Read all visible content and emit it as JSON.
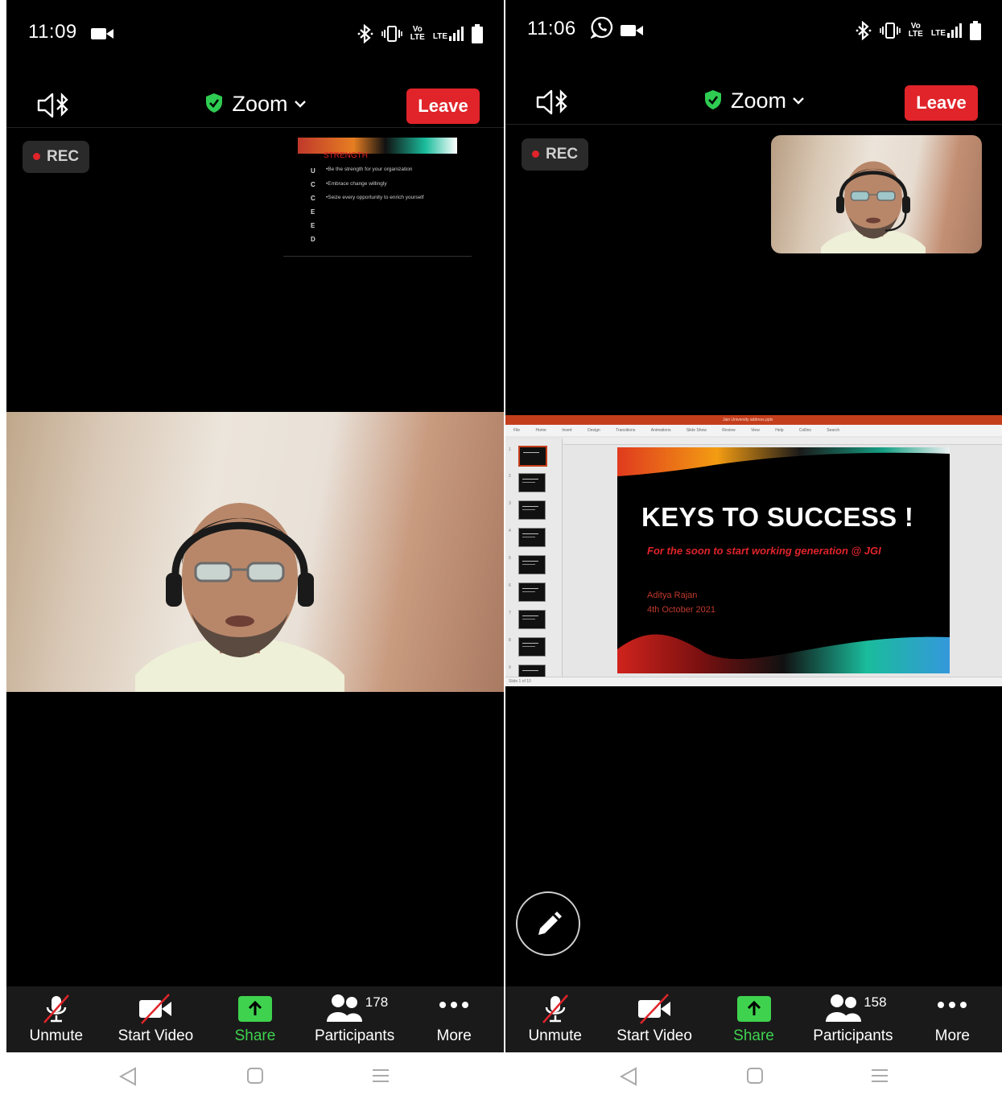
{
  "left": {
    "status": {
      "time": "11:09",
      "volte_top": "Vo",
      "volte_bottom": "LTE",
      "lte": "LTE"
    },
    "header": {
      "title": "Zoom",
      "leave_label": "Leave"
    },
    "rec_label": "REC",
    "shared_slide": {
      "heading": "STRENGTH",
      "side_letters": [
        "U",
        "C",
        "C",
        "E",
        "E",
        "D"
      ],
      "bullets": [
        "•Be the strength for your organization",
        "•Embrace change willingly",
        "•Seize every opportunity to enrich yourself"
      ]
    },
    "toolbar": {
      "unmute": "Unmute",
      "start_video": "Start Video",
      "share": "Share",
      "participants": "Participants",
      "participants_count": "178",
      "more": "More"
    }
  },
  "right": {
    "status": {
      "time": "11:06",
      "volte_top": "Vo",
      "volte_bottom": "LTE",
      "lte": "LTE"
    },
    "header": {
      "title": "Zoom",
      "leave_label": "Leave"
    },
    "rec_label": "REC",
    "presentation": {
      "window_title": "Jain University address.pptx",
      "menu": [
        "File",
        "Home",
        "Insert",
        "Design",
        "Transitions",
        "Animations",
        "Slide Show",
        "Review",
        "View",
        "Help",
        "Collins",
        "Search"
      ],
      "slide_title": "KEYS TO SUCCESS !",
      "slide_subtitle": "For the soon to start working generation @ JGI",
      "slide_author": "Aditya Rajan",
      "slide_date": "4th October 2021",
      "status_text": "Slide 1 of 10"
    },
    "toolbar": {
      "unmute": "Unmute",
      "start_video": "Start Video",
      "share": "Share",
      "participants": "Participants",
      "participants_count": "158",
      "more": "More"
    }
  },
  "colors": {
    "leave": "#e0242a",
    "share": "#3fd24f",
    "shield": "#2ecc52",
    "rec_dot": "#e0242a"
  }
}
